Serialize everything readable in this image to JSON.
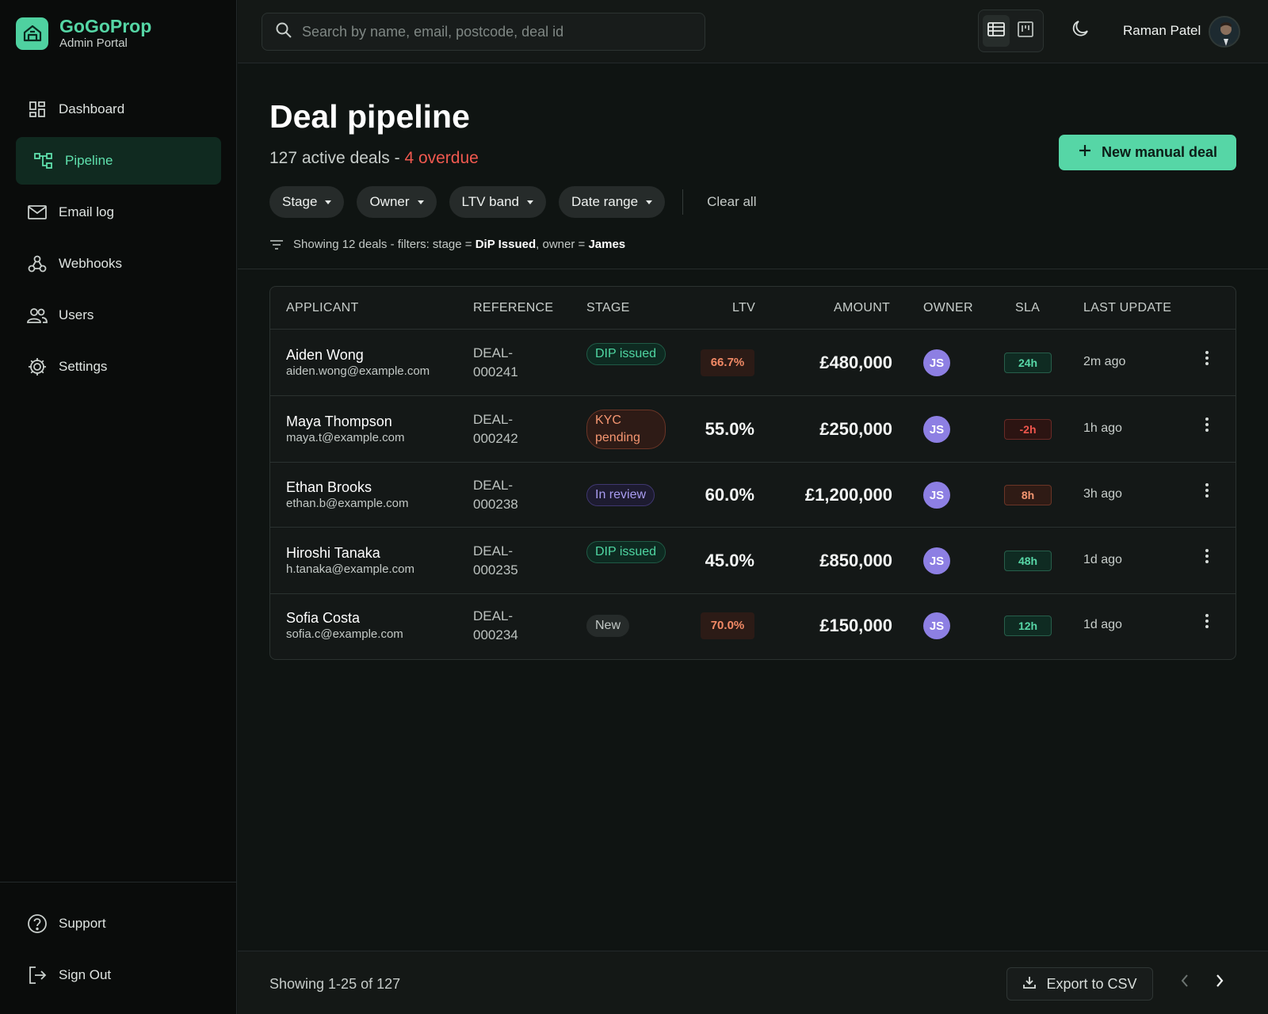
{
  "brand": {
    "name": "GoGoProp",
    "subtitle": "Admin Portal"
  },
  "sidebar": {
    "items": [
      {
        "label": "Dashboard",
        "icon": "dashboard-icon",
        "active": false
      },
      {
        "label": "Pipeline",
        "icon": "pipeline-icon",
        "active": true
      },
      {
        "label": "Email log",
        "icon": "mail-icon",
        "active": false
      },
      {
        "label": "Webhooks",
        "icon": "webhook-icon",
        "active": false
      },
      {
        "label": "Users",
        "icon": "users-icon",
        "active": false
      },
      {
        "label": "Settings",
        "icon": "gear-icon",
        "active": false
      }
    ],
    "bottom": [
      {
        "label": "Support",
        "icon": "help-icon"
      },
      {
        "label": "Sign Out",
        "icon": "sign-out-icon"
      }
    ]
  },
  "topbar": {
    "search_placeholder": "Search by name, email, postcode, deal id",
    "user_name": "Raman Patel"
  },
  "header": {
    "title": "Deal pipeline",
    "active_count": "127 active deals - ",
    "overdue": "4 overdue",
    "new_deal_label": "New manual deal"
  },
  "filters": {
    "chips": [
      "Stage",
      "Owner",
      "LTV band",
      "Date range"
    ],
    "clear_label": "Clear all",
    "summary_prefix": "Showing 12 deals - filters: stage = ",
    "summary_stage": "DiP Issued",
    "summary_mid": ", owner = ",
    "summary_owner": "James"
  },
  "table": {
    "columns": [
      "APPLICANT",
      "REFERENCE",
      "STAGE",
      "LTV",
      "AMOUNT",
      "OWNER",
      "SLA",
      "LAST UPDATE"
    ],
    "rows": [
      {
        "name": "Aiden Wong",
        "email": "aiden.wong@example.com",
        "ref1": "DEAL-",
        "ref2": "000241",
        "stage": "DIP issued",
        "stage_style": "green",
        "ltv": "66.7%",
        "ltv_flag": true,
        "amount": "£480,000",
        "owner": "JS",
        "sla": "24h",
        "sla_style": "green",
        "updated": "2m ago"
      },
      {
        "name": "Maya Thompson",
        "email": "maya.t@example.com",
        "ref1": "DEAL-",
        "ref2": "000242",
        "stage": "KYC pending",
        "stage_style": "orange",
        "ltv": "55.0%",
        "ltv_flag": false,
        "amount": "£250,000",
        "owner": "JS",
        "sla": "-2h",
        "sla_style": "red",
        "updated": "1h ago"
      },
      {
        "name": "Ethan Brooks",
        "email": "ethan.b@example.com",
        "ref1": "DEAL-",
        "ref2": "000238",
        "stage": "In review",
        "stage_style": "purple",
        "ltv": "60.0%",
        "ltv_flag": false,
        "amount": "£1,200,000",
        "owner": "JS",
        "sla": "8h",
        "sla_style": "orange",
        "updated": "3h ago"
      },
      {
        "name": "Hiroshi Tanaka",
        "email": "h.tanaka@example.com",
        "ref1": "DEAL-",
        "ref2": "000235",
        "stage": "DIP issued",
        "stage_style": "green",
        "ltv": "45.0%",
        "ltv_flag": false,
        "amount": "£850,000",
        "owner": "JS",
        "sla": "48h",
        "sla_style": "green",
        "updated": "1d ago"
      },
      {
        "name": "Sofia Costa",
        "email": "sofia.c@example.com",
        "ref1": "DEAL-",
        "ref2": "000234",
        "stage": "New",
        "stage_style": "gray",
        "ltv": "70.0%",
        "ltv_flag": true,
        "amount": "£150,000",
        "owner": "JS",
        "sla": "12h",
        "sla_style": "green",
        "updated": "1d ago"
      }
    ]
  },
  "footer": {
    "showing": "Showing 1-25 of 127",
    "export_label": "Export to CSV"
  },
  "colors": {
    "accent": "#55d6a5",
    "danger": "#f0594f",
    "owner_avatar": "#8d7fe3"
  }
}
